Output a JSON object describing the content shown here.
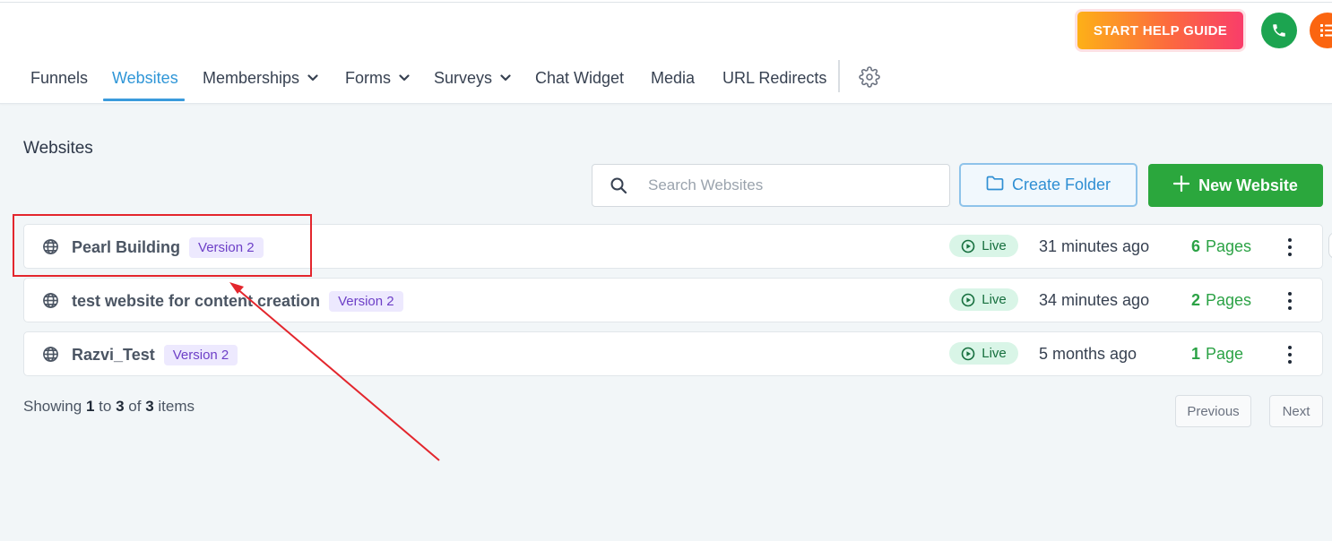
{
  "header": {
    "help_guide_label": "START HELP GUIDE",
    "icons": {
      "phone": "phone-icon",
      "list": "list-icon"
    }
  },
  "nav": {
    "items": [
      {
        "label": "Funnels",
        "has_dropdown": false,
        "active": false
      },
      {
        "label": "Websites",
        "has_dropdown": false,
        "active": true
      },
      {
        "label": "Memberships",
        "has_dropdown": true,
        "active": false
      },
      {
        "label": "Forms",
        "has_dropdown": true,
        "active": false
      },
      {
        "label": "Surveys",
        "has_dropdown": true,
        "active": false
      },
      {
        "label": "Chat Widget",
        "has_dropdown": false,
        "active": false
      },
      {
        "label": "Media",
        "has_dropdown": false,
        "active": false
      },
      {
        "label": "URL Redirects",
        "has_dropdown": false,
        "active": false
      }
    ],
    "settings_icon": "gear-icon"
  },
  "main": {
    "title": "Websites",
    "search": {
      "placeholder": "Search Websites",
      "value": ""
    },
    "create_folder_label": "Create Folder",
    "new_website_label": "New Website",
    "websites": [
      {
        "name": "Pearl Building",
        "version": "Version 2",
        "status": "Live",
        "updated": "31 minutes ago",
        "page_count": "6",
        "page_word": "Pages"
      },
      {
        "name": "test website for content creation",
        "version": "Version 2",
        "status": "Live",
        "updated": "34 minutes ago",
        "page_count": "2",
        "page_word": "Pages"
      },
      {
        "name": "Razvi_Test",
        "version": "Version 2",
        "status": "Live",
        "updated": "5 months ago",
        "page_count": "1",
        "page_word": "Page"
      }
    ],
    "pagination": {
      "showing_prefix": "Showing",
      "from": "1",
      "to_word": "to",
      "to": "3",
      "of_word": "of",
      "total": "3",
      "items_word": "items",
      "previous_label": "Previous",
      "next_label": "Next"
    }
  },
  "colors": {
    "accent_blue": "#2f96d7",
    "green": "#2ba73d",
    "live_bg": "#d9f5e7",
    "version_bg": "#ede9fe",
    "annotation_red": "#e3262d"
  }
}
